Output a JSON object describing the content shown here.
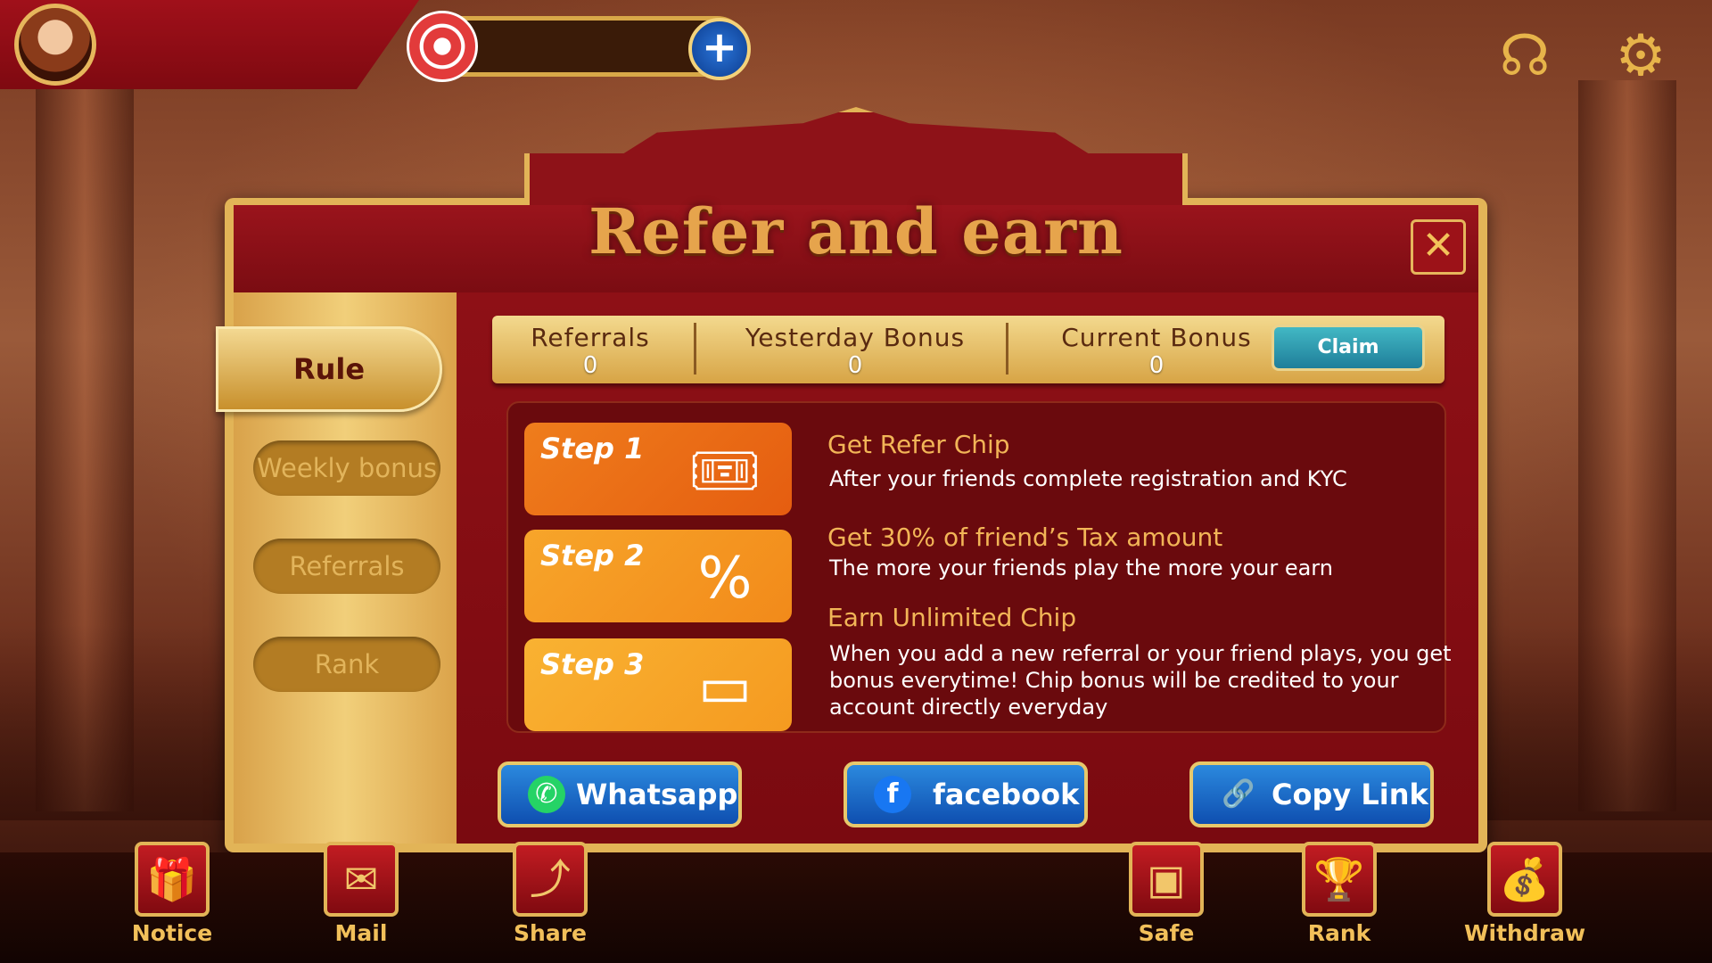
{
  "header": {
    "plus_label": "+"
  },
  "dialog": {
    "title": "Refer and earn",
    "close_label": "✕"
  },
  "tabs": [
    {
      "label": "Rule",
      "active": true
    },
    {
      "label": "Weekly bonus",
      "active": false
    },
    {
      "label": "Referrals",
      "active": false
    },
    {
      "label": "Rank",
      "active": false
    }
  ],
  "stats": {
    "referrals": {
      "label": "Referrals",
      "value": "0"
    },
    "yesterday": {
      "label": "Yesterday Bonus",
      "value": "0"
    },
    "current": {
      "label": "Current Bonus",
      "value": "0"
    },
    "claim_label": "Claim"
  },
  "steps": [
    {
      "label": "Step 1",
      "icon": "ticket-icon",
      "heading": "Get Refer Chip",
      "text": "After your friends complete registration and KYC"
    },
    {
      "label": "Step 2",
      "icon": "percent-tag-icon",
      "heading": "Get 30% of friend’s Tax amount",
      "text": "The more your friends play the more your earn"
    },
    {
      "label": "Step 3",
      "icon": "wallet-icon",
      "heading": "Earn Unlimited Chip",
      "text_lines": [
        "When you add a new referral or your friend plays, you get",
        "bonus everytime! Chip bonus will be credited to your",
        "account directly everyday"
      ]
    }
  ],
  "share": {
    "whatsapp": "Whatsapp",
    "facebook": "facebook",
    "copy": "Copy Link"
  },
  "bottom_nav": [
    {
      "label": "Notice",
      "icon": "gift-icon"
    },
    {
      "label": "Mail",
      "icon": "mail-icon"
    },
    {
      "label": "Share",
      "icon": "share-icon"
    },
    {
      "label": "Safe",
      "icon": "safe-icon"
    },
    {
      "label": "Rank",
      "icon": "trophy-icon"
    },
    {
      "label": "Withdraw",
      "icon": "money-bag-icon"
    }
  ],
  "colors": {
    "gold": "#e2b457",
    "crimson": "#8e1016",
    "step1": "#e66a14",
    "step2": "#f59a20",
    "step3": "#f7a928",
    "whatsapp_green": "#25d366",
    "facebook_blue": "#1877f2"
  }
}
